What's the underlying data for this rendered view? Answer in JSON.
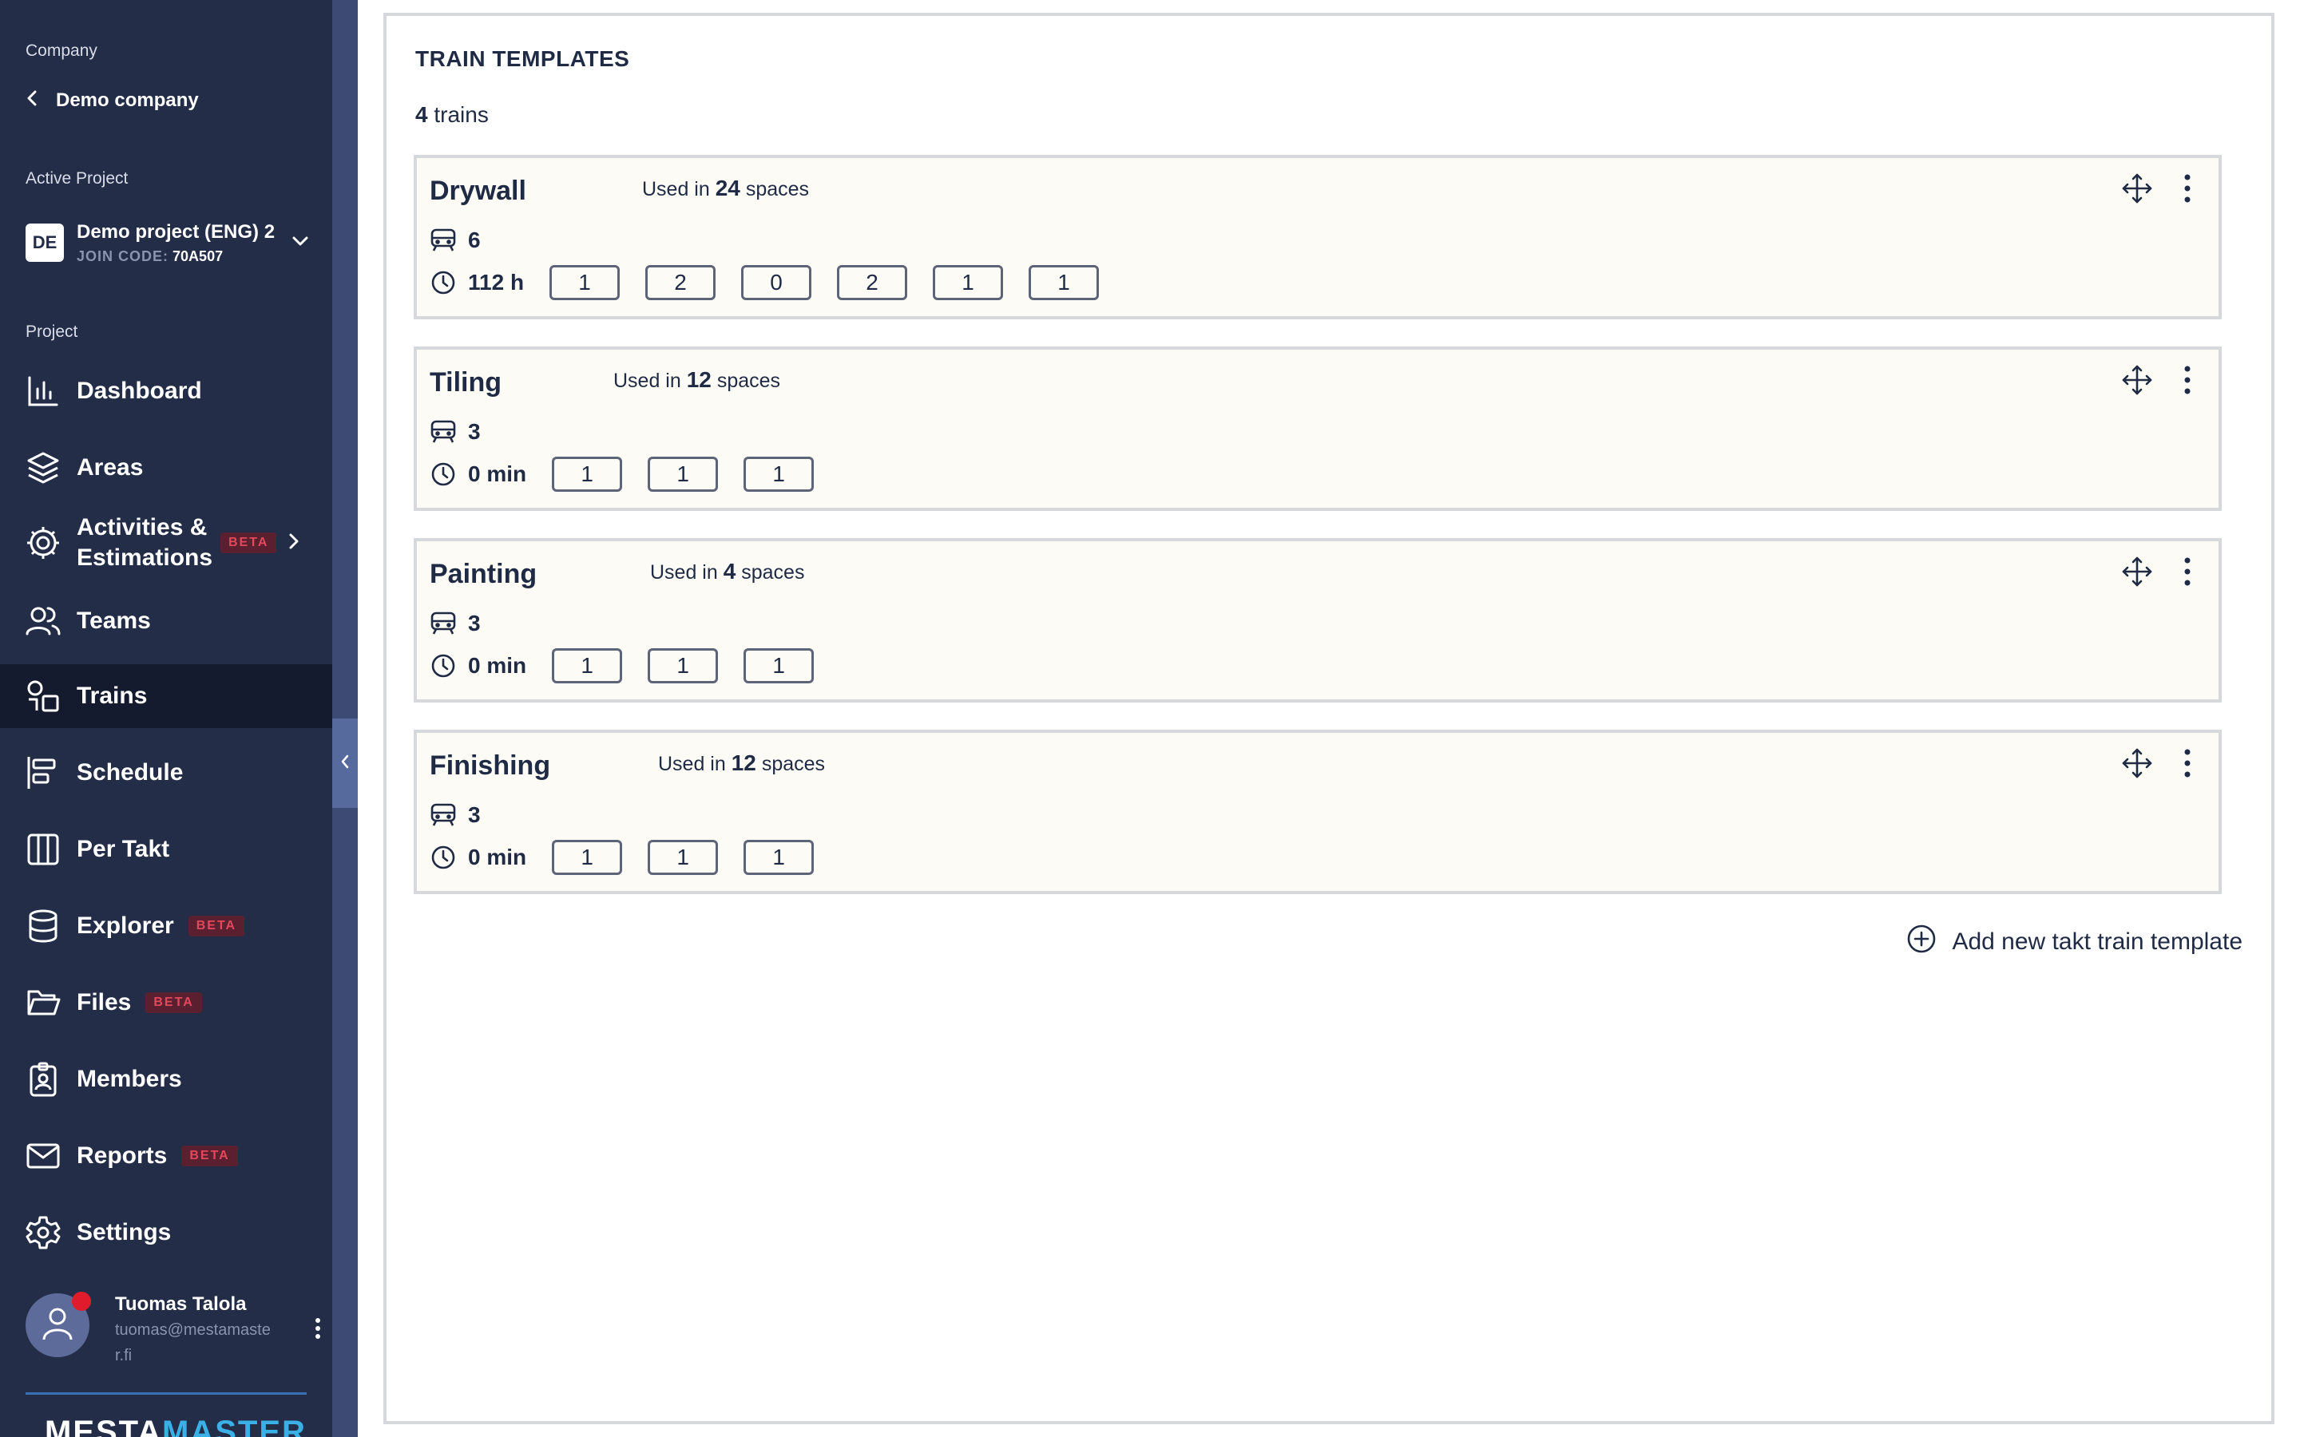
{
  "sidebar": {
    "company_label": "Company",
    "company_name": "Demo company",
    "active_project_label": "Active Project",
    "project": {
      "badge": "DE",
      "name": "Demo project (ENG) 2",
      "join_code_label": "JOIN CODE:",
      "join_code": "70A507"
    },
    "project_label": "Project",
    "items": [
      {
        "label": "Dashboard",
        "icon": "chart-bar-icon"
      },
      {
        "label": "Areas",
        "icon": "layers-icon"
      },
      {
        "label": "Activities & Estimations",
        "icon": "gear-cog-icon",
        "badge": "BETA"
      },
      {
        "label": "Teams",
        "icon": "users-icon"
      },
      {
        "label": "Trains",
        "icon": "train-shapes-icon",
        "active": true
      },
      {
        "label": "Schedule",
        "icon": "gantt-icon"
      },
      {
        "label": "Per Takt",
        "icon": "columns-icon"
      },
      {
        "label": "Explorer",
        "icon": "database-icon",
        "badge": "BETA"
      },
      {
        "label": "Files",
        "icon": "folder-icon",
        "badge": "BETA"
      },
      {
        "label": "Members",
        "icon": "badge-id-icon"
      },
      {
        "label": "Reports",
        "icon": "mail-icon",
        "badge": "BETA"
      },
      {
        "label": "Settings",
        "icon": "gear-icon"
      }
    ],
    "user": {
      "name": "Tuomas Talola",
      "email": "tuomas@mestamaster.fi"
    },
    "logo": {
      "part1": "MESTA",
      "part2": "MASTER"
    }
  },
  "main": {
    "title": "TRAIN TEMPLATES",
    "train_count": "4",
    "train_count_suffix": "trains",
    "used_in_prefix": "Used in",
    "used_in_suffix": "spaces",
    "templates": [
      {
        "name": "Drywall",
        "used_in": "24",
        "wagons": "6",
        "duration": "112 h",
        "wagon_values": [
          "1",
          "2",
          "0",
          "2",
          "1",
          "1"
        ]
      },
      {
        "name": "Tiling",
        "used_in": "12",
        "wagons": "3",
        "duration": "0 min",
        "wagon_values": [
          "1",
          "1",
          "1"
        ]
      },
      {
        "name": "Painting",
        "used_in": "4",
        "wagons": "3",
        "duration": "0 min",
        "wagon_values": [
          "1",
          "1",
          "1"
        ]
      },
      {
        "name": "Finishing",
        "used_in": "12",
        "wagons": "3",
        "duration": "0 min",
        "wagon_values": [
          "1",
          "1",
          "1"
        ]
      }
    ],
    "add_template_label": "Add new takt train template"
  }
}
